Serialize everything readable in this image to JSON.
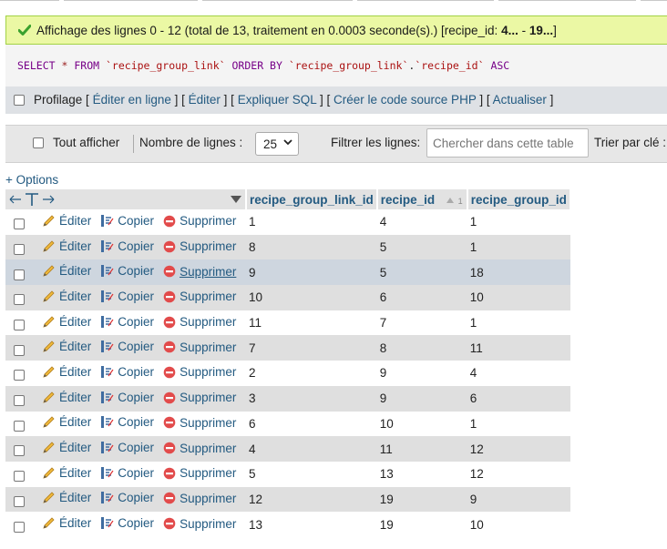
{
  "message": {
    "text": "Affichage des lignes 0 - 12 (total de 13, traitement en 0.0003 seconde(s).) [recipe_id: ",
    "bold1": "4...",
    "mid": " - ",
    "bold2": "19...",
    "end": "]",
    "icon": "check-icon"
  },
  "sql": {
    "select": "SELECT",
    "star": "*",
    "from": "FROM",
    "table": "`recipe_group_link`",
    "orderby": "ORDER BY",
    "col_table": "`recipe_group_link`",
    "dot": ".",
    "col": "`recipe_id`",
    "asc": "ASC"
  },
  "profiling": {
    "label": "Profilage",
    "links": [
      "Éditer en ligne",
      "Éditer",
      "Expliquer SQL",
      "Créer le code source PHP",
      "Actualiser"
    ]
  },
  "navigation": {
    "show_all": "Tout afficher",
    "rows_label": "Nombre de lignes :",
    "rows_value": "25",
    "filter_label": "Filtrer les lignes:",
    "filter_placeholder": "Chercher dans cette table",
    "sort_label": "Trier par clé :"
  },
  "options_link": "+ Options",
  "table": {
    "columns": [
      "recipe_group_link_id",
      "recipe_id",
      "recipe_group_id"
    ],
    "sort_indicator": "1",
    "action_labels": {
      "edit": "Éditer",
      "copy": "Copier",
      "delete": "Supprimer"
    },
    "rows": [
      [
        "1",
        "4",
        "1"
      ],
      [
        "8",
        "5",
        "1"
      ],
      [
        "9",
        "5",
        "18"
      ],
      [
        "10",
        "6",
        "10"
      ],
      [
        "11",
        "7",
        "1"
      ],
      [
        "7",
        "8",
        "11"
      ],
      [
        "2",
        "9",
        "4"
      ],
      [
        "3",
        "9",
        "6"
      ],
      [
        "6",
        "10",
        "1"
      ],
      [
        "4",
        "11",
        "12"
      ],
      [
        "5",
        "13",
        "12"
      ],
      [
        "12",
        "19",
        "9"
      ],
      [
        "13",
        "19",
        "10"
      ]
    ]
  },
  "colors": {
    "link": "#235a81",
    "success_bg": "#ebf8a4",
    "highlight_row": "#ced6df",
    "even_row": "#dfdfdf"
  }
}
